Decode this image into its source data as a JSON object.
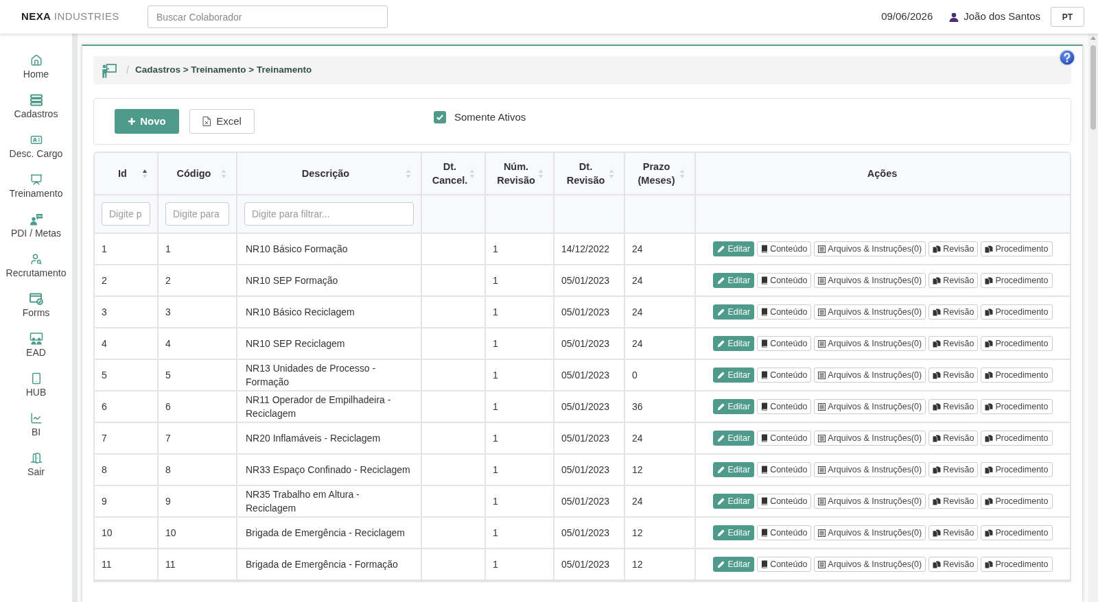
{
  "header": {
    "logo": {
      "strong": "NEXA",
      "light": "INDUSTRIES"
    },
    "search": {
      "placeholder": "Buscar Colaborador"
    },
    "date": "09/06/2026",
    "user": "João dos Santos",
    "language": "PT"
  },
  "sidebar": {
    "items": [
      {
        "label": "Home"
      },
      {
        "label": "Cadastros"
      },
      {
        "label": "Desc. Cargo"
      },
      {
        "label": "Treinamento"
      },
      {
        "label": "PDI / Metas"
      },
      {
        "label": "Recrutamento"
      },
      {
        "label": "Forms"
      },
      {
        "label": "EAD"
      },
      {
        "label": "HUB"
      },
      {
        "label": "BI"
      },
      {
        "label": "Sair"
      }
    ]
  },
  "breadcrumb": {
    "separator": "/",
    "path": "Cadastros > Treinamento > Treinamento"
  },
  "toolbar": {
    "buttons": [
      {
        "label": "Novo",
        "kind": "new"
      },
      {
        "label": "Excel",
        "kind": "export"
      }
    ],
    "active_filter": {
      "label": "Somente Ativos",
      "checked": true
    }
  },
  "table": {
    "columns": [
      {
        "label": "Id",
        "sortable": true,
        "sorted": true,
        "filter": {
          "placeholder": "Digite p"
        }
      },
      {
        "label": "Código",
        "sortable": true,
        "sorted": false,
        "filter": {
          "placeholder": "Digite para"
        }
      },
      {
        "label": "Descrição",
        "sortable": true,
        "sorted": false,
        "filter": {
          "placeholder": "Digite para filtrar..."
        }
      },
      {
        "label": "Dt. Cancel.",
        "sortable": true,
        "sorted": false
      },
      {
        "label": "Núm. Revisão",
        "sortable": true,
        "sorted": false
      },
      {
        "label": "Dt. Revisão",
        "sortable": true,
        "sorted": false
      },
      {
        "label": "Prazo (Meses)",
        "sortable": true,
        "sorted": false
      },
      {
        "label": "Ações",
        "sortable": false
      }
    ],
    "rows": [
      {
        "id": "1",
        "code": "1",
        "description": "NR10 Básico Formação",
        "revision": "1",
        "revision_date": "14/12/2022",
        "term": "24",
        "actions": [
          {
            "label": "Editar",
            "kind": "edit"
          },
          {
            "label": "Conteúdo",
            "kind": "content"
          },
          {
            "label": "Arquivos & Instruções(0)",
            "kind": "files"
          },
          {
            "label": "Revisão",
            "kind": "revision"
          },
          {
            "label": "Procedimento",
            "kind": "procedure"
          }
        ]
      },
      {
        "id": "2",
        "code": "2",
        "description": "NR10 SEP Formação",
        "revision": "1",
        "revision_date": "05/01/2023",
        "term": "24",
        "actions": [
          {
            "label": "Editar",
            "kind": "edit"
          },
          {
            "label": "Conteúdo",
            "kind": "content"
          },
          {
            "label": "Arquivos & Instruções(0)",
            "kind": "files"
          },
          {
            "label": "Revisão",
            "kind": "revision"
          },
          {
            "label": "Procedimento",
            "kind": "procedure"
          }
        ]
      },
      {
        "id": "3",
        "code": "3",
        "description": "NR10 Básico Reciclagem",
        "revision": "1",
        "revision_date": "05/01/2023",
        "term": "24",
        "actions": [
          {
            "label": "Editar",
            "kind": "edit"
          },
          {
            "label": "Conteúdo",
            "kind": "content"
          },
          {
            "label": "Arquivos & Instruções(0)",
            "kind": "files"
          },
          {
            "label": "Revisão",
            "kind": "revision"
          },
          {
            "label": "Procedimento",
            "kind": "procedure"
          }
        ]
      },
      {
        "id": "4",
        "code": "4",
        "description": "NR10 SEP Reciclagem",
        "revision": "1",
        "revision_date": "05/01/2023",
        "term": "24",
        "actions": [
          {
            "label": "Editar",
            "kind": "edit"
          },
          {
            "label": "Conteúdo",
            "kind": "content"
          },
          {
            "label": "Arquivos & Instruções(0)",
            "kind": "files"
          },
          {
            "label": "Revisão",
            "kind": "revision"
          },
          {
            "label": "Procedimento",
            "kind": "procedure"
          }
        ]
      },
      {
        "id": "5",
        "code": "5",
        "description": "NR13 Unidades de Processo - Formação",
        "revision": "1",
        "revision_date": "05/01/2023",
        "term": "0",
        "actions": [
          {
            "label": "Editar",
            "kind": "edit"
          },
          {
            "label": "Conteúdo",
            "kind": "content"
          },
          {
            "label": "Arquivos & Instruções(0)",
            "kind": "files"
          },
          {
            "label": "Revisão",
            "kind": "revision"
          },
          {
            "label": "Procedimento",
            "kind": "procedure"
          }
        ]
      },
      {
        "id": "6",
        "code": "6",
        "description": "NR11 Operador de Empilhadeira - Reciclagem",
        "revision": "1",
        "revision_date": "05/01/2023",
        "term": "36",
        "actions": [
          {
            "label": "Editar",
            "kind": "edit"
          },
          {
            "label": "Conteúdo",
            "kind": "content"
          },
          {
            "label": "Arquivos & Instruções(0)",
            "kind": "files"
          },
          {
            "label": "Revisão",
            "kind": "revision"
          },
          {
            "label": "Procedimento",
            "kind": "procedure"
          }
        ]
      },
      {
        "id": "7",
        "code": "7",
        "description": "NR20 Inflamáveis - Reciclagem",
        "revision": "1",
        "revision_date": "05/01/2023",
        "term": "24",
        "actions": [
          {
            "label": "Editar",
            "kind": "edit"
          },
          {
            "label": "Conteúdo",
            "kind": "content"
          },
          {
            "label": "Arquivos & Instruções(0)",
            "kind": "files"
          },
          {
            "label": "Revisão",
            "kind": "revision"
          },
          {
            "label": "Procedimento",
            "kind": "procedure"
          }
        ]
      },
      {
        "id": "8",
        "code": "8",
        "description": "NR33 Espaço Confinado - Reciclagem",
        "revision": "1",
        "revision_date": "05/01/2023",
        "term": "12",
        "actions": [
          {
            "label": "Editar",
            "kind": "edit"
          },
          {
            "label": "Conteúdo",
            "kind": "content"
          },
          {
            "label": "Arquivos & Instruções(0)",
            "kind": "files"
          },
          {
            "label": "Revisão",
            "kind": "revision"
          },
          {
            "label": "Procedimento",
            "kind": "procedure"
          }
        ]
      },
      {
        "id": "9",
        "code": "9",
        "description": "NR35 Trabalho em Altura - Reciclagem",
        "revision": "1",
        "revision_date": "05/01/2023",
        "term": "24",
        "actions": [
          {
            "label": "Editar",
            "kind": "edit"
          },
          {
            "label": "Conteúdo",
            "kind": "content"
          },
          {
            "label": "Arquivos & Instruções(0)",
            "kind": "files"
          },
          {
            "label": "Revisão",
            "kind": "revision"
          },
          {
            "label": "Procedimento",
            "kind": "procedure"
          }
        ]
      },
      {
        "id": "10",
        "code": "10",
        "description": "Brigada de Emergência - Reciclagem",
        "revision": "1",
        "revision_date": "05/01/2023",
        "term": "12",
        "actions": [
          {
            "label": "Editar",
            "kind": "edit"
          },
          {
            "label": "Conteúdo",
            "kind": "content"
          },
          {
            "label": "Arquivos & Instruções(0)",
            "kind": "files"
          },
          {
            "label": "Revisão",
            "kind": "revision"
          },
          {
            "label": "Procedimento",
            "kind": "procedure"
          }
        ]
      },
      {
        "id": "11",
        "code": "11",
        "description": "Brigada de Emergência - Formação",
        "revision": "1",
        "revision_date": "05/01/2023",
        "term": "12",
        "actions": [
          {
            "label": "Editar",
            "kind": "edit"
          },
          {
            "label": "Conteúdo",
            "kind": "content"
          },
          {
            "label": "Arquivos & Instruções(0)",
            "kind": "files"
          },
          {
            "label": "Revisão",
            "kind": "revision"
          },
          {
            "label": "Procedimento",
            "kind": "procedure"
          }
        ]
      }
    ]
  }
}
